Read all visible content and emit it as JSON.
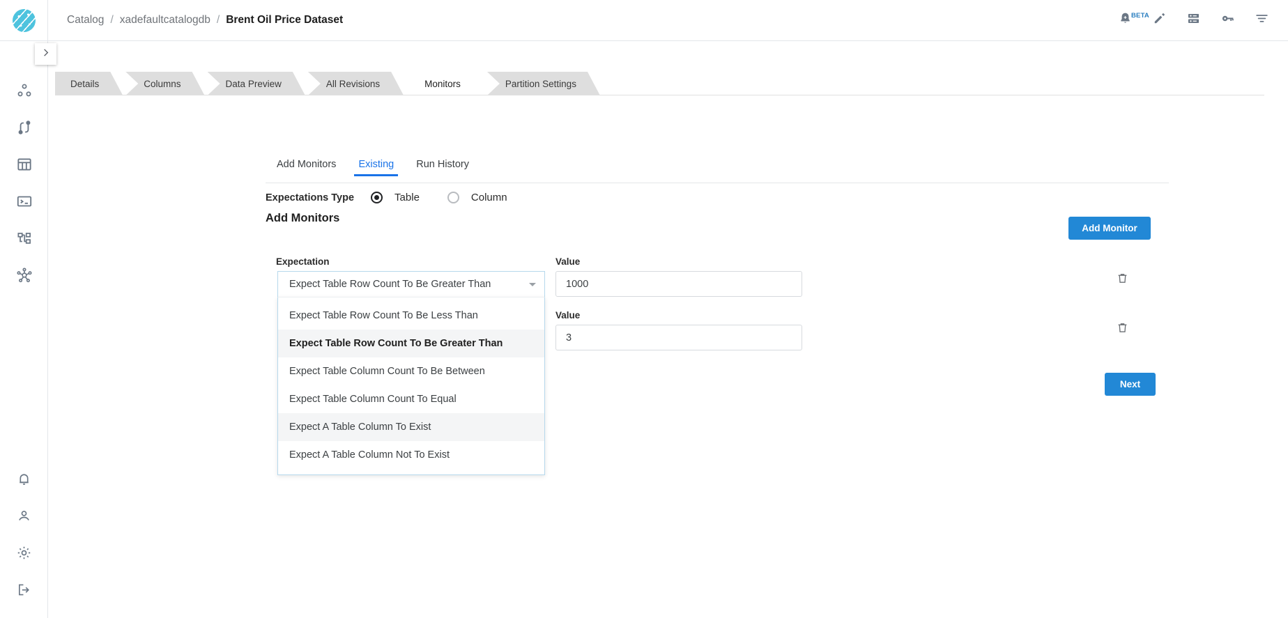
{
  "app": {
    "logo_icon": "globe-network-logo"
  },
  "header": {
    "breadcrumb": [
      {
        "label": "Catalog",
        "current": false
      },
      {
        "label": "xadefaultcatalogdb",
        "current": false
      },
      {
        "label": "Brent Oil Price Dataset",
        "current": true
      }
    ],
    "separator": "/",
    "actions": [
      {
        "name": "notifications-add-icon",
        "badge": "BETA"
      },
      {
        "name": "edit-pencil-icon",
        "badge": ""
      },
      {
        "name": "database-icon",
        "badge": ""
      },
      {
        "name": "key-icon",
        "badge": ""
      },
      {
        "name": "filter-icon",
        "badge": ""
      }
    ]
  },
  "sidebar": {
    "expand_icon": "chevron-right-icon",
    "top_items": [
      {
        "name": "data-nodes-icon"
      },
      {
        "name": "pipeline-icon"
      },
      {
        "name": "table-icon"
      },
      {
        "name": "terminal-icon"
      },
      {
        "name": "hierarchy-icon"
      },
      {
        "name": "network-hub-icon"
      }
    ],
    "bottom_items": [
      {
        "name": "bell-icon"
      },
      {
        "name": "user-icon"
      },
      {
        "name": "gear-icon"
      },
      {
        "name": "logout-icon"
      }
    ]
  },
  "tabs": [
    {
      "label": "Details",
      "active": false
    },
    {
      "label": "Columns",
      "active": false
    },
    {
      "label": "Data Preview",
      "active": false
    },
    {
      "label": "All Revisions",
      "active": false
    },
    {
      "label": "Monitors",
      "active": true
    },
    {
      "label": "Partition Settings",
      "active": false
    }
  ],
  "subtabs": [
    {
      "label": "Add Monitors",
      "active": false
    },
    {
      "label": "Existing",
      "active": true
    },
    {
      "label": "Run History",
      "active": false
    }
  ],
  "expectations_type": {
    "label": "Expectations Type",
    "options": [
      {
        "label": "Table",
        "checked": true
      },
      {
        "label": "Column",
        "checked": false
      }
    ]
  },
  "section": {
    "title": "Add Monitors",
    "add_monitor_label": "Add Monitor",
    "next_label": "Next"
  },
  "form": {
    "expectation_label": "Expectation",
    "value_label_1": "Value",
    "value_label_2": "Value",
    "select": {
      "value": "Expect Table Row Count To Be Greater Than",
      "open": true,
      "caret_icon": "chevron-down-icon",
      "options": [
        {
          "label": "Expect Table Row Count To Be Less Than",
          "state": "normal"
        },
        {
          "label": "Expect Table Row Count To Be Greater Than",
          "state": "selected"
        },
        {
          "label": "Expect Table Column Count To Be Between",
          "state": "normal"
        },
        {
          "label": "Expect Table Column Count To Equal",
          "state": "normal"
        },
        {
          "label": "Expect A Table Column To Exist",
          "state": "hovered"
        },
        {
          "label": "Expect A Table Column Not To Exist",
          "state": "normal"
        }
      ]
    },
    "values": [
      {
        "value": "1000",
        "placeholder": "Value",
        "delete_icon": "trash-icon"
      },
      {
        "value": "3",
        "placeholder": "Value",
        "delete_icon": "trash-icon"
      }
    ]
  },
  "colors": {
    "primary_blue": "#2288d6",
    "active_tab_blue": "#1a73e8",
    "logo_teal": "#4ec3de",
    "tab_gray": "#dedede"
  }
}
